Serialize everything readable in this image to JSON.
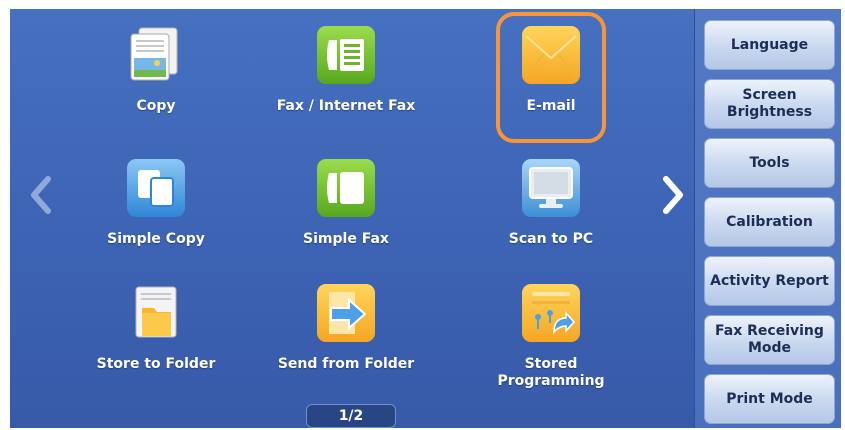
{
  "apps": [
    {
      "label": "Copy",
      "icon": "copy-icon"
    },
    {
      "label": "Fax / Internet Fax",
      "icon": "fax-internet-fax-icon"
    },
    {
      "label": "E-mail",
      "icon": "email-icon",
      "selected": true
    },
    {
      "label": "Simple Copy",
      "icon": "simple-copy-icon"
    },
    {
      "label": "Simple Fax",
      "icon": "simple-fax-icon"
    },
    {
      "label": "Scan to PC",
      "icon": "scan-to-pc-icon"
    },
    {
      "label": "Store to Folder",
      "icon": "store-to-folder-icon"
    },
    {
      "label": "Send from Folder",
      "icon": "send-from-folder-icon"
    },
    {
      "label": "Stored\nProgramming",
      "icon": "stored-programming-icon"
    }
  ],
  "sidebar": [
    {
      "label": "Language"
    },
    {
      "label": "Screen\nBrightness"
    },
    {
      "label": "Tools"
    },
    {
      "label": "Calibration"
    },
    {
      "label": "Activity Report"
    },
    {
      "label": "Fax Receiving\nMode"
    },
    {
      "label": "Print Mode"
    }
  ],
  "pager": {
    "text": "1/2"
  },
  "colors": {
    "background": "#3d63b4",
    "highlight": "#f7953b",
    "button": "#c9d8ef"
  }
}
